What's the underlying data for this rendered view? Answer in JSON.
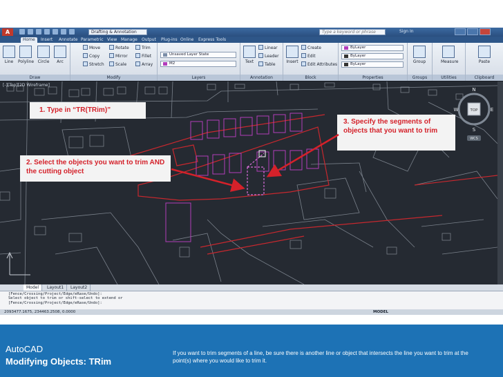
{
  "titlebar": {
    "logo": "A",
    "workspace": "Drafting & Annotation",
    "search_placeholder": "Type a keyword or phrase",
    "sign_in": "Sign In"
  },
  "ribbon_tabs": [
    "Home",
    "Insert",
    "Annotate",
    "Parametric",
    "View",
    "Manage",
    "Output",
    "Plug-ins",
    "Online",
    "Express Tools"
  ],
  "ribbon": {
    "draw": {
      "title": "Draw",
      "tools": [
        "Line",
        "Polyline",
        "Circle",
        "Arc"
      ]
    },
    "modify": {
      "title": "Modify",
      "rows": [
        [
          "Move",
          "Rotate",
          "Trim"
        ],
        [
          "Copy",
          "Mirror",
          "Fillet"
        ],
        [
          "Stretch",
          "Scale",
          "Array"
        ]
      ]
    },
    "layers": {
      "title": "Layers",
      "state": "Unsaved Layer State",
      "current": "M2"
    },
    "annotation": {
      "title": "Annotation",
      "big": "Text",
      "items": [
        "Linear",
        "Leader",
        "Table"
      ]
    },
    "block": {
      "title": "Block",
      "big": "Insert",
      "items": [
        "Create",
        "Edit",
        "Edit Attributes"
      ]
    },
    "properties": {
      "title": "Properties",
      "color": "ByLayer",
      "linetype": "ByLayer",
      "lineweight": "ByLayer"
    },
    "groups": {
      "title": "Groups",
      "big": "Group"
    },
    "utilities": {
      "title": "Utilities",
      "big": "Measure"
    },
    "clipboard": {
      "title": "Clipboard",
      "big": "Paste"
    }
  },
  "viewport_label": "[-][Top][2D Wireframe]",
  "viewcube": {
    "north": "N",
    "south": "S",
    "east": "E",
    "west": "W",
    "face": "TOP",
    "ucs": "WCS"
  },
  "layout_tabs": [
    "Model",
    "Layout1",
    "Layout2"
  ],
  "command_lines": [
    "[Fence/Crossing/Project/Edge/eRase/Undo]:",
    "Select object to trim or shift-select to extend or",
    "[Fence/Crossing/Project/Edge/eRase/Undo]:"
  ],
  "status": {
    "coords": "2093477.1675, 234463.2508, 0.0000",
    "space": "MODEL"
  },
  "callouts": {
    "step1": "1. Type in “TR(TRim)”",
    "step2": "2. Select the objects you want to trim AND the cutting object",
    "step3": "3. Specify the segments of objects that you want to trim"
  },
  "footer": {
    "app": "AutoCAD",
    "topic": "Modifying Objects: TRim",
    "description": "If you want to trim segments of a line, be sure there is another line or object that intersects the line you want to trim at the point(s) where you would like to trim it."
  },
  "colors": {
    "accent": "#d4212a",
    "footer": "#1d72b5",
    "layer_magenta": "#b23dbb",
    "boundary_red": "#c8282e"
  }
}
